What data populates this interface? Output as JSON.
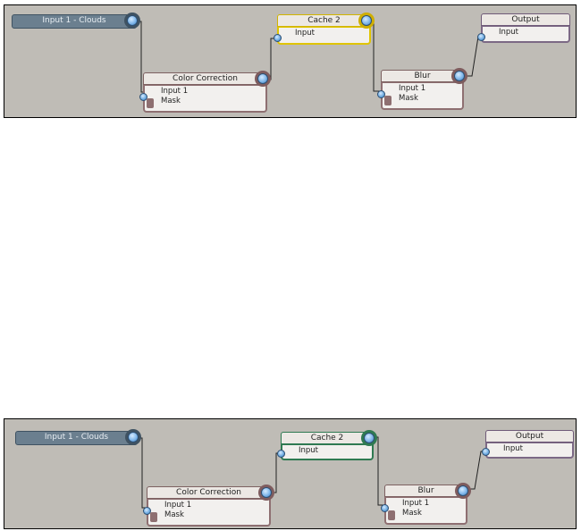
{
  "graphs": [
    {
      "nodes": {
        "input": {
          "title": "Input 1 - Clouds"
        },
        "color_correction": {
          "title": "Color Correction",
          "ports": [
            "Input 1",
            "Mask"
          ]
        },
        "cache": {
          "title": "Cache 2",
          "ports": [
            "Input"
          ],
          "highlight_color": "#e0c400"
        },
        "blur": {
          "title": "Blur",
          "ports": [
            "Input 1",
            "Mask"
          ]
        },
        "output": {
          "title": "Output",
          "ports": [
            "Input"
          ]
        }
      }
    },
    {
      "nodes": {
        "input": {
          "title": "Input 1 - Clouds"
        },
        "color_correction": {
          "title": "Color Correction",
          "ports": [
            "Input 1",
            "Mask"
          ]
        },
        "cache": {
          "title": "Cache 2",
          "ports": [
            "Input"
          ],
          "highlight_color": "#2f7a52"
        },
        "blur": {
          "title": "Blur",
          "ports": [
            "Input 1",
            "Mask"
          ]
        },
        "output": {
          "title": "Output",
          "ports": [
            "Input"
          ]
        }
      }
    }
  ],
  "colors": {
    "canvas_background": "#bfbcb6",
    "node_border": "#8e6f71",
    "input_node": "#6b7f8f",
    "port_blue": "#6ba9e0"
  }
}
